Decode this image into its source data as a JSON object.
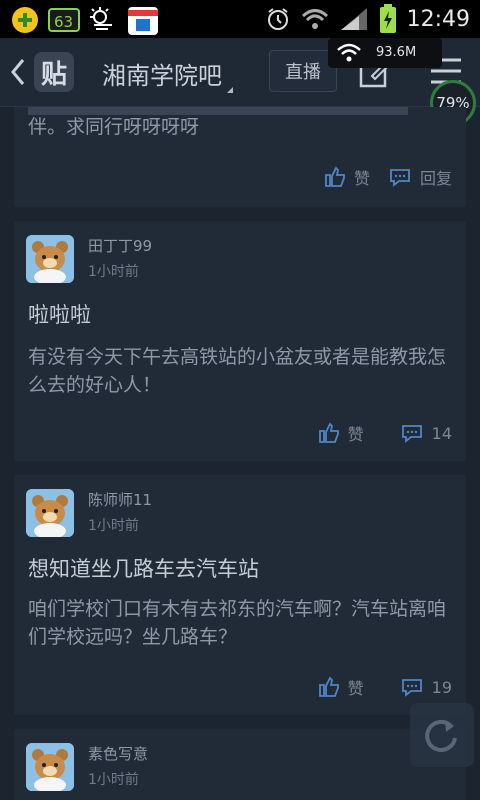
{
  "status_bar": {
    "time": "12:49",
    "left_icons": [
      "qihoo-icon",
      "app-icon-63",
      "weather-icon",
      "store-icon"
    ],
    "right_icons": [
      "alarm-icon",
      "wifi-icon",
      "signal-icon",
      "battery-charging-icon"
    ]
  },
  "network_overlay": {
    "speed": "93.6M"
  },
  "memory_badge": {
    "percent": "79%"
  },
  "header": {
    "logo": "贴",
    "title": "湘南学院吧",
    "live_label": "直播"
  },
  "posts": [
    {
      "partial": true,
      "body": "伴。求同行呀呀呀呀",
      "like_label": "赞",
      "reply_label": "回复"
    },
    {
      "username": "田丁丁99",
      "time": "1小时前",
      "title": "啦啦啦",
      "body": "有没有今天下午去高铁站的小盆友或者是能教我怎么去的好心人！",
      "like_label": "赞",
      "reply_count": "14"
    },
    {
      "username": "陈师师11",
      "time": "1小时前",
      "title": "想知道坐几路车去汽车站",
      "body": "咱们学校门口有木有去祁东的汽车啊？汽车站离咱们学校远吗？坐几路车？",
      "like_label": "赞",
      "reply_count": "19"
    },
    {
      "username": "素色写意",
      "time": "1小时前"
    }
  ],
  "colors": {
    "accent": "#4f86c6",
    "background": "#1c2430",
    "card": "#212b38"
  }
}
